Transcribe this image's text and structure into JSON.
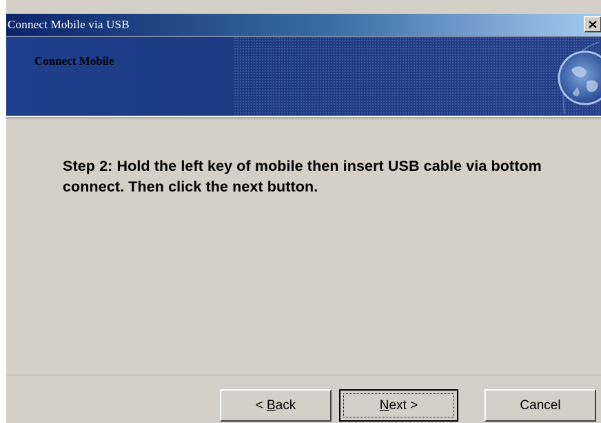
{
  "window": {
    "title": "Connect Mobile via USB",
    "close_glyph": "close-icon"
  },
  "banner": {
    "title": "Connect Mobile",
    "graphic": "globe-icon"
  },
  "content": {
    "step_text": "Step 2: Hold the left key of mobile then insert USB cable via bottom connect. Then click the next button."
  },
  "buttons": {
    "back": {
      "prefix": "< ",
      "mnemonic": "B",
      "rest": "ack"
    },
    "next": {
      "mnemonic": "N",
      "rest": "ext >"
    },
    "cancel": {
      "label": "Cancel"
    }
  },
  "colors": {
    "titlebar_start": "#0a246a",
    "titlebar_end": "#a6caf0",
    "banner": "#1f3f8c",
    "dialog_face": "#d4d0c8"
  }
}
